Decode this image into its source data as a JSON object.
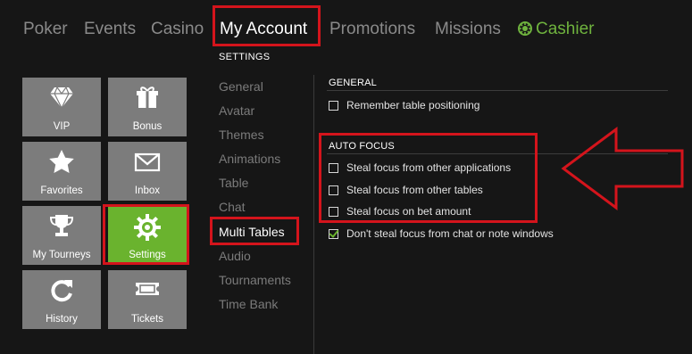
{
  "topnav": {
    "items": [
      "Poker",
      "Events",
      "Casino",
      "My Account",
      "Promotions",
      "Missions"
    ],
    "cashier": "Cashier",
    "active": "My Account"
  },
  "subheading": "SETTINGS",
  "tiles": [
    {
      "label": "VIP",
      "icon": "diamond-icon"
    },
    {
      "label": "Bonus",
      "icon": "gift-icon"
    },
    {
      "label": "Favorites",
      "icon": "star-icon"
    },
    {
      "label": "Inbox",
      "icon": "envelope-icon"
    },
    {
      "label": "My Tourneys",
      "icon": "trophy-icon"
    },
    {
      "label": "Settings",
      "icon": "gear-icon"
    },
    {
      "label": "History",
      "icon": "refresh-icon"
    },
    {
      "label": "Tickets",
      "icon": "ticket-icon"
    }
  ],
  "settings_menu": [
    "General",
    "Avatar",
    "Themes",
    "Animations",
    "Table",
    "Chat",
    "Multi Tables",
    "Audio",
    "Tournaments",
    "Time Bank"
  ],
  "active_menu": "Multi Tables",
  "general": {
    "title": "GENERAL",
    "options": [
      {
        "label": "Remember table positioning",
        "checked": false
      }
    ]
  },
  "auto_focus": {
    "title": "AUTO FOCUS",
    "options": [
      {
        "label": "Steal focus from other applications",
        "checked": false
      },
      {
        "label": "Steal focus from other tables",
        "checked": false
      },
      {
        "label": "Steal focus on bet amount",
        "checked": false
      },
      {
        "label": "Don't steal focus from chat or note windows",
        "checked": true
      }
    ]
  },
  "colors": {
    "highlight": "#d4141c",
    "accent_green": "#6ab32e",
    "background": "#161616"
  }
}
